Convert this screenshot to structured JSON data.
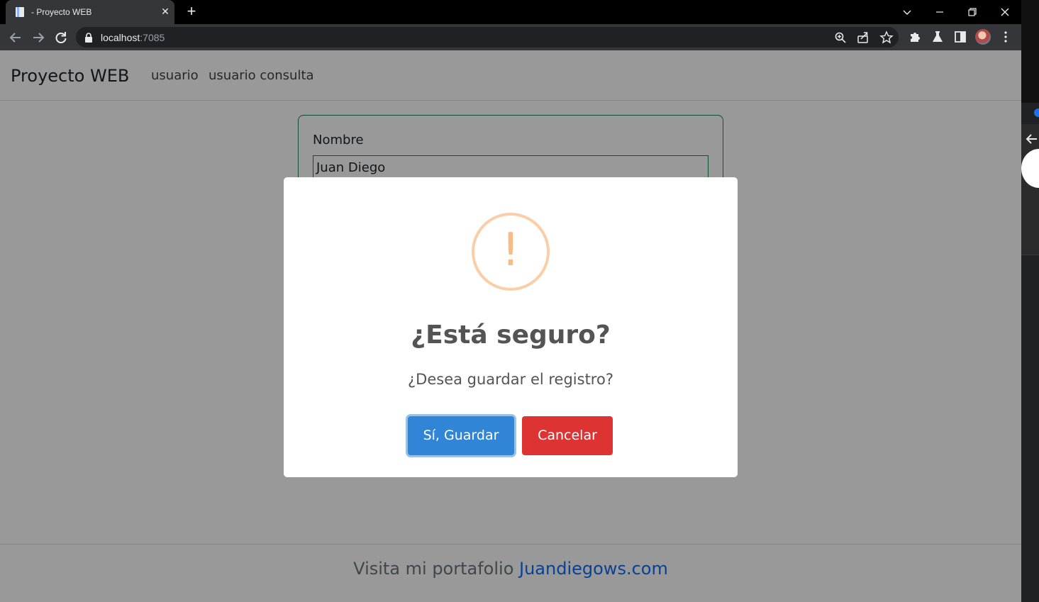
{
  "browser": {
    "tab_title": "- Proyecto WEB",
    "url_host": "localhost",
    "url_port": ":7085"
  },
  "navbar": {
    "brand": "Proyecto WEB",
    "links": [
      "usuario",
      "usuario consulta"
    ]
  },
  "form": {
    "label": "Nombre",
    "value": "Juan Diego"
  },
  "modal": {
    "title": "¿Está seguro?",
    "text": "¿Desea guardar el registro?",
    "icon": "!",
    "confirm_label": "Sí, Guardar",
    "cancel_label": "Cancelar"
  },
  "footer": {
    "text": "Visita mi portafolio ",
    "link": "Juandiegows.com"
  },
  "colors": {
    "confirm": "#3085d6",
    "cancel": "#dd3333",
    "warning": "#f8bb86",
    "success_border": "#198754",
    "link": "#0d6efd"
  }
}
